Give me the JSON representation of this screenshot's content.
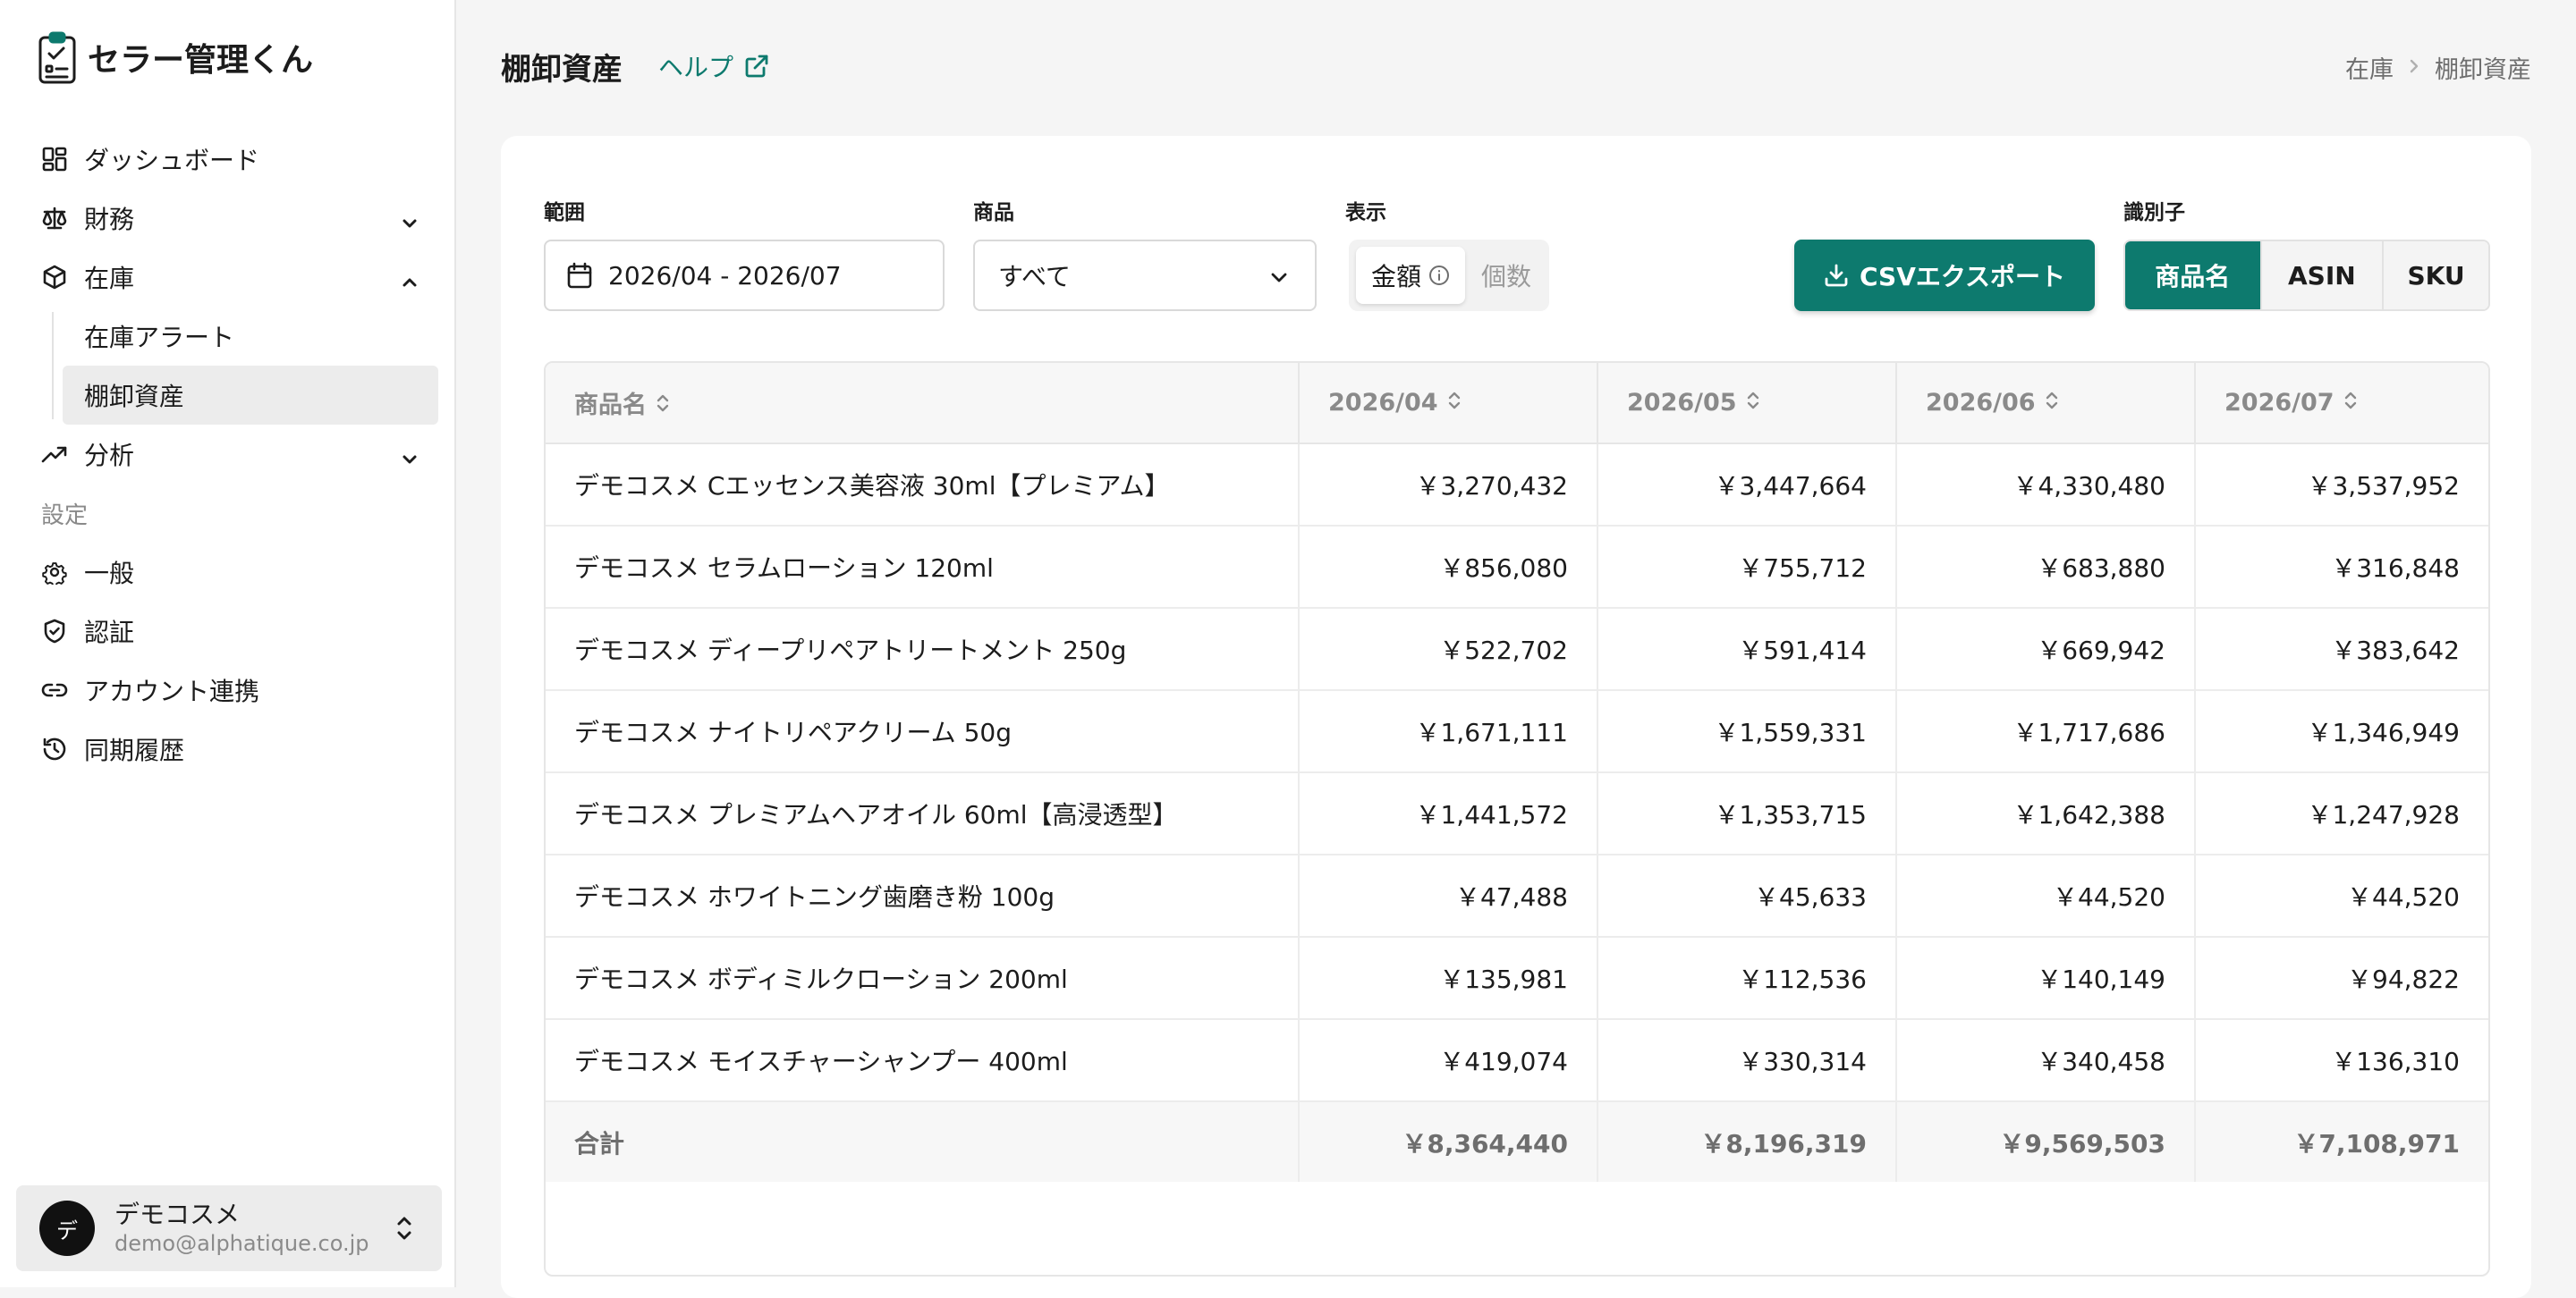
{
  "app": {
    "name": "セラー管理くん"
  },
  "sidebar": {
    "items": [
      {
        "label": "ダッシュボード"
      },
      {
        "label": "財務"
      },
      {
        "label": "在庫"
      },
      {
        "label": "分析"
      }
    ],
    "inventory_sub": [
      {
        "label": "在庫アラート"
      },
      {
        "label": "棚卸資産"
      }
    ],
    "settings_label": "設定",
    "settings": [
      {
        "label": "一般"
      },
      {
        "label": "認証"
      },
      {
        "label": "アカウント連携"
      },
      {
        "label": "同期履歴"
      }
    ]
  },
  "account": {
    "initial": "デ",
    "name": "デモコスメ",
    "email": "demo@alphatique.co.jp"
  },
  "header": {
    "title": "棚卸資産",
    "help": "ヘルプ",
    "breadcrumb": [
      "在庫",
      "棚卸資産"
    ]
  },
  "filters": {
    "range_label": "範囲",
    "range_value": "2026/04 - 2026/07",
    "product_label": "商品",
    "product_value": "すべて",
    "display_label": "表示",
    "display_on": "金額",
    "display_off": "個数",
    "csv_button": "CSVエクスポート",
    "identifier_label": "識別子",
    "identifier_options": [
      "商品名",
      "ASIN",
      "SKU"
    ]
  },
  "table": {
    "headers": [
      "商品名",
      "2026/04",
      "2026/05",
      "2026/06",
      "2026/07"
    ],
    "rows": [
      [
        "デモコスメ Cエッセンス美容液 30ml【プレミアム】",
        "￥3,270,432",
        "￥3,447,664",
        "￥4,330,480",
        "￥3,537,952"
      ],
      [
        "デモコスメ セラムローション 120ml",
        "￥856,080",
        "￥755,712",
        "￥683,880",
        "￥316,848"
      ],
      [
        "デモコスメ ディープリペアトリートメント 250g",
        "￥522,702",
        "￥591,414",
        "￥669,942",
        "￥383,642"
      ],
      [
        "デモコスメ ナイトリペアクリーム 50g",
        "￥1,671,111",
        "￥1,559,331",
        "￥1,717,686",
        "￥1,346,949"
      ],
      [
        "デモコスメ プレミアムヘアオイル 60ml【高浸透型】",
        "￥1,441,572",
        "￥1,353,715",
        "￥1,642,388",
        "￥1,247,928"
      ],
      [
        "デモコスメ ホワイトニング歯磨き粉 100g",
        "￥47,488",
        "￥45,633",
        "￥44,520",
        "￥44,520"
      ],
      [
        "デモコスメ ボディミルクローション 200ml",
        "￥135,981",
        "￥112,536",
        "￥140,149",
        "￥94,822"
      ],
      [
        "デモコスメ モイスチャーシャンプー 400ml",
        "￥419,074",
        "￥330,314",
        "￥340,458",
        "￥136,310"
      ]
    ],
    "total": [
      "合計",
      "￥8,364,440",
      "￥8,196,319",
      "￥9,569,503",
      "￥7,108,971"
    ]
  },
  "colors": {
    "accent": "#0d7a6e"
  }
}
